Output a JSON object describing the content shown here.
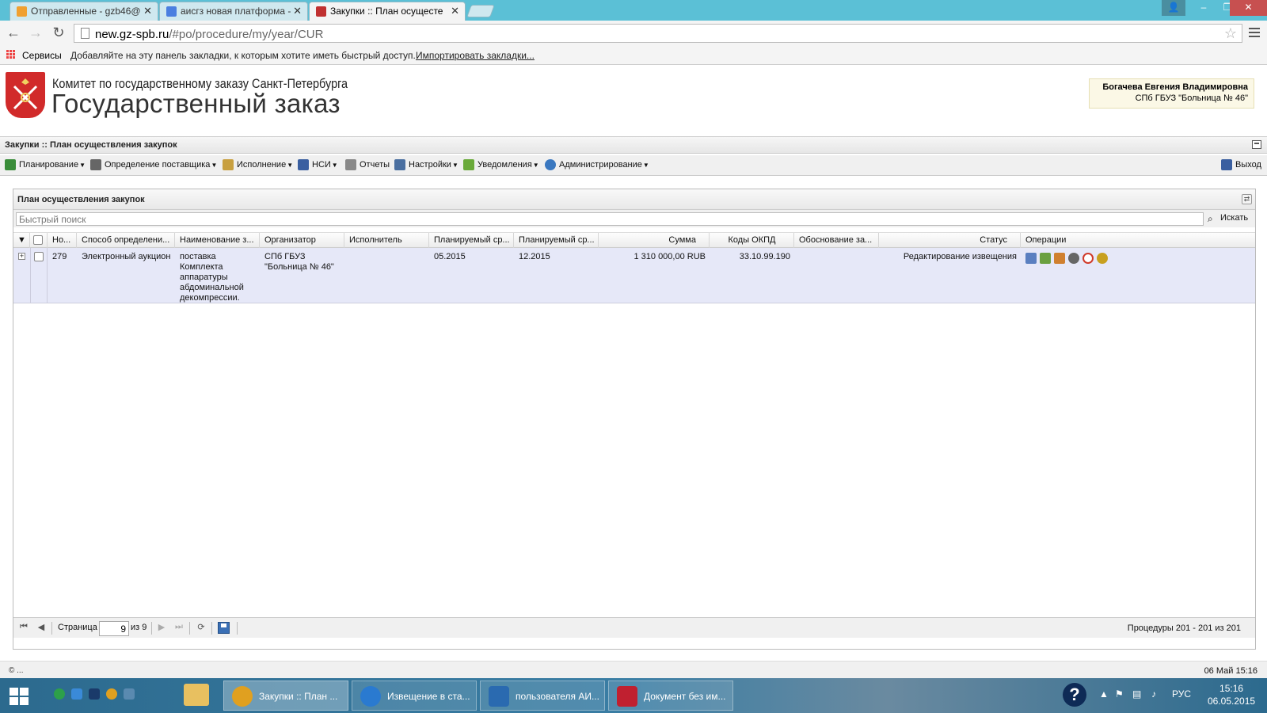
{
  "browser": {
    "tabs": [
      {
        "label": "Отправленные - gzb46@",
        "icon_color": "#f0a030"
      },
      {
        "label": "аисгз новая платформа -",
        "icon_color": "#4a7fe0"
      },
      {
        "label": "Закупки :: План осущесте",
        "icon_color": "#c03030"
      }
    ],
    "url_host": "new.gz-spb.ru",
    "url_path": "/#po/procedure/my/year/CUR",
    "bookmarks_apps_label": "Сервисы",
    "bookmarks_hint": "Добавляйте на эту панель закладки, к которым хотите иметь быстрый доступ.",
    "bookmarks_import": "Импортировать закладки..."
  },
  "header": {
    "committee": "Комитет по государственному заказу Санкт-Петербурга",
    "title": "Государственный заказ",
    "user_name": "Богачева Евгения Владимировна",
    "user_org": "СПб ГБУЗ \"Больница № 46\""
  },
  "module_title": "Закупки :: План осуществления закупок",
  "menu": {
    "items": [
      {
        "label": "Планирование",
        "icon": "planning-icon",
        "color": "#3a8d3a"
      },
      {
        "label": "Определение поставщика",
        "icon": "gears-icon",
        "color": "#666666"
      },
      {
        "label": "Исполнение",
        "icon": "execution-icon",
        "color": "#c8a040"
      },
      {
        "label": "НСИ",
        "icon": "book-icon",
        "color": "#3a5fa0"
      },
      {
        "label": "Отчеты",
        "icon": "report-icon",
        "color": "#888888"
      },
      {
        "label": "Настройки",
        "icon": "wrench-icon",
        "color": "#4a6fa0"
      },
      {
        "label": "Уведомления",
        "icon": "notification-icon",
        "color": "#6aaa3a"
      },
      {
        "label": "Администрирование",
        "icon": "user-icon",
        "color": "#3a78c0"
      }
    ],
    "logout": "Выход"
  },
  "panel": {
    "title": "План осуществления закупок",
    "search_placeholder": "Быстрый поиск",
    "search_button": "Искать",
    "columns": [
      "Но...",
      "Способ определени...",
      "Наименование з...",
      "Организатор",
      "Исполнитель",
      "Планируемый ср...",
      "Планируемый ср...",
      "Сумма",
      "Коды ОКПД",
      "Обоснование за...",
      "Статус",
      "Операции"
    ],
    "rows": [
      {
        "number": "279",
        "method": "Электронный аукцион",
        "name": "поставка Комплекта аппаратуры абдоминальной декомпрессии.",
        "organizer": "СПб ГБУЗ \"Больница № 46\"",
        "executor": "",
        "plan_start": "05.2015",
        "plan_end": "12.2015",
        "sum": "1 310 000,00 RUB",
        "okpd": "33.10.99.190",
        "justification": "",
        "status": "Редактирование извещения",
        "operations": [
          {
            "icon": "edit-icon",
            "color": "#5a7fc0"
          },
          {
            "icon": "tag-icon",
            "color": "#6aa040"
          },
          {
            "icon": "chart-icon",
            "color": "#d08030"
          },
          {
            "icon": "settings-icon",
            "color": "#666666"
          },
          {
            "icon": "refresh-icon",
            "color": "#d03a2a"
          },
          {
            "icon": "emblem-icon",
            "color": "#c8a020"
          }
        ]
      }
    ]
  },
  "pager": {
    "page_label": "Страница",
    "page_value": "9",
    "of_label": "из 9",
    "records": "Процедуры 201 - 201 из 201"
  },
  "footer": {
    "copyright": "© ...",
    "datetime": "06 Май 15:16"
  },
  "taskbar": {
    "buttons": [
      {
        "label": "Закупки :: План ...",
        "color": "#e0a020"
      },
      {
        "label": "Извещение в ста...",
        "color": "#2a7ad0"
      },
      {
        "label": "пользователя АИ...",
        "color": "#2a6ab0"
      },
      {
        "label": "Документ без им...",
        "color": "#c02030"
      }
    ],
    "lang": "РУС",
    "time": "15:16",
    "date": "06.05.2015"
  }
}
